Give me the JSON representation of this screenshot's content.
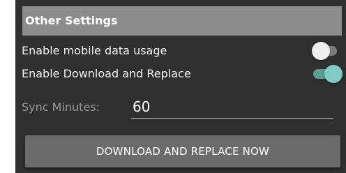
{
  "section": {
    "title": "Other Settings"
  },
  "settings": {
    "mobile_data": {
      "label": "Enable mobile data usage",
      "enabled": false
    },
    "download_replace": {
      "label": "Enable Download and Replace",
      "enabled": true
    }
  },
  "sync": {
    "label": "Sync Minutes:",
    "value": "60"
  },
  "action": {
    "label": "DOWNLOAD AND REPLACE NOW"
  },
  "colors": {
    "panel_background": "#303030",
    "header_background": "#8c8c8c",
    "switch_on_accent": "#80cbc4",
    "button_background": "#6b6b6b"
  }
}
